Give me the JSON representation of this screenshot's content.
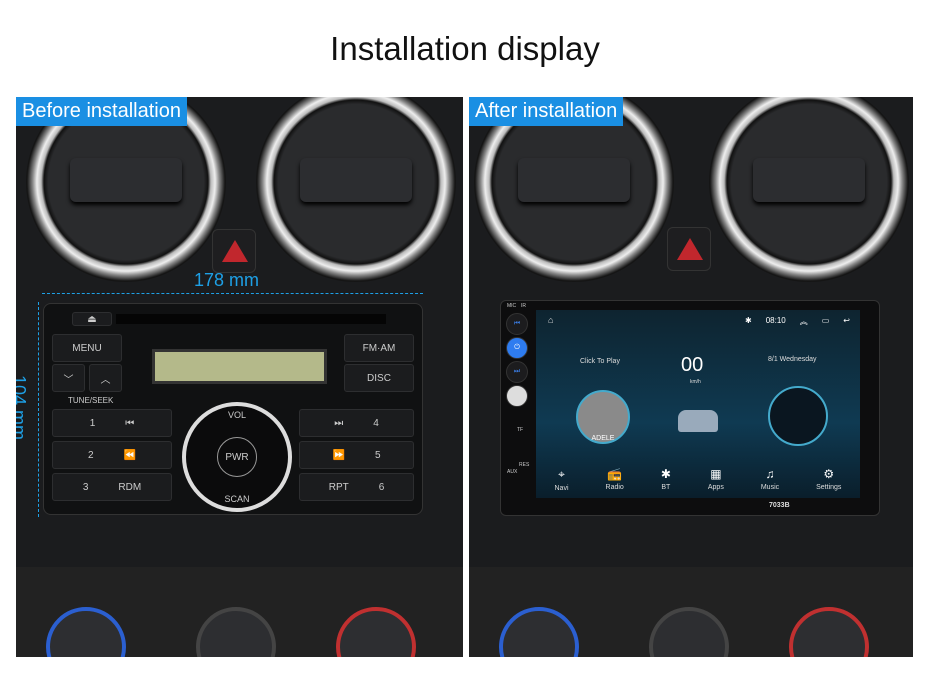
{
  "title": "Installation display",
  "before": {
    "label": "Before installation",
    "width_dim": "178 mm",
    "height_dim": "104 mm",
    "radio": {
      "buttons": {
        "eject": "⏏",
        "menu": "MENU",
        "down": "﹀",
        "up": "︿",
        "fm_am": "FM·AM",
        "disc": "DISC",
        "tune_seek": "TUNE/SEEK",
        "vol": "VOL",
        "pwr": "PWR",
        "scan": "SCAN"
      },
      "presets": [
        {
          "num": "1",
          "label": "⏮"
        },
        {
          "num": "2",
          "label": "⏪"
        },
        {
          "num": "3",
          "label": "RDM"
        },
        {
          "num": "4",
          "label": "⏭"
        },
        {
          "num": "5",
          "label": "⏩"
        },
        {
          "num": "6",
          "label": "RPT"
        }
      ]
    }
  },
  "after": {
    "label": "After installation",
    "model": "7033B",
    "side": {
      "mic": "MIC",
      "ir": "IR",
      "tf": "TF",
      "aux": "AUX",
      "res": "RES"
    },
    "screen": {
      "time": "08:10",
      "click_to_play": "Click To Play",
      "speed": "00",
      "speed_unit": "km/h",
      "date": "8/1  Wednesday",
      "album": "ADELE",
      "apps": [
        {
          "label": "Navi",
          "icon": "⌖"
        },
        {
          "label": "Radio",
          "icon": "📻"
        },
        {
          "label": "BT",
          "icon": "✱"
        },
        {
          "label": "Apps",
          "icon": "▦"
        },
        {
          "label": "Music",
          "icon": "♫"
        },
        {
          "label": "Settings",
          "icon": "⚙"
        }
      ]
    }
  },
  "colors": {
    "accent": "#1a8fe3",
    "dimension": "#1ea0e6"
  }
}
